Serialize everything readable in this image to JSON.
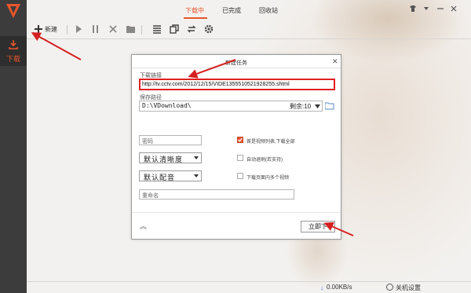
{
  "app": {
    "tabs": [
      {
        "label": "下载中",
        "active": true
      },
      {
        "label": "已完成",
        "active": false
      },
      {
        "label": "回收站",
        "active": false
      }
    ],
    "sidebar": {
      "download_label": "下载"
    },
    "accent_color": "#e8552b"
  },
  "toolbar": {
    "new_label": "新建",
    "icons": [
      "plus-icon",
      "play-icon",
      "pause-icon",
      "delete-icon",
      "folder-icon",
      "list-icon",
      "copy-icon",
      "refresh-icon",
      "settings-icon"
    ]
  },
  "status": {
    "speed": "0.00KB/s",
    "shutdown": "关机设置"
  },
  "dialog": {
    "title": "新建任务",
    "url_label": "下载链接",
    "url_value": "http://tv.cctv.com/2012/12/15/VIDE1355510521928255.shtml",
    "path_label": "保存路径",
    "path_value": "D:\\VDownload\\",
    "remain_label": "剩余:10",
    "password_placeholder": "密码",
    "quality_value": "默认清晰度",
    "dub_value": "默认配音",
    "rename_placeholder": "重命名",
    "opt_first_playlist": "首是视频列表,下载全部",
    "opt_first_playlist_checked": true,
    "opt_auto_exit": "自动退刷(若支持)",
    "opt_auto_exit_checked": false,
    "opt_multi_video": "下载页面内多个视频",
    "opt_multi_video_checked": false,
    "start_button": "立即下"
  }
}
